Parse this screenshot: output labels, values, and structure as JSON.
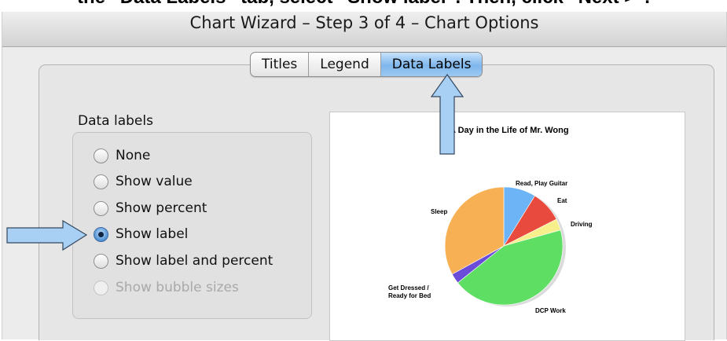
{
  "caption": {
    "prefix": "the “Data Labels” tab, select “",
    "bold_option": "Show label",
    "suffix": "”. Then, click “Next >”."
  },
  "window": {
    "title": "Chart Wizard – Step 3 of 4 – Chart Options"
  },
  "tabs": [
    {
      "label": "Titles",
      "selected": false
    },
    {
      "label": "Legend",
      "selected": false
    },
    {
      "label": "Data Labels",
      "selected": true
    }
  ],
  "data_labels": {
    "group_title": "Data labels",
    "options": [
      {
        "label": "None",
        "checked": false,
        "enabled": true
      },
      {
        "label": "Show value",
        "checked": false,
        "enabled": true
      },
      {
        "label": "Show percent",
        "checked": false,
        "enabled": true
      },
      {
        "label": "Show label",
        "checked": true,
        "enabled": true
      },
      {
        "label": "Show label and percent",
        "checked": false,
        "enabled": true
      },
      {
        "label": "Show bubble sizes",
        "checked": false,
        "enabled": false
      }
    ]
  },
  "preview": {
    "title": "A Day in the Life of Mr. Wong",
    "slices": [
      {
        "label": "Read, Play Guitar",
        "color": "#6cb4f5"
      },
      {
        "label": "Eat",
        "color": "#e84a3d"
      },
      {
        "label": "Driving",
        "color": "#f7ef8c"
      },
      {
        "label": "DCP Work",
        "color": "#5fde64"
      },
      {
        "label": "Get Dressed / Ready for Bed",
        "color": "#6b4cd9"
      },
      {
        "label": "Sleep",
        "color": "#f8b055"
      }
    ]
  },
  "annotation_arrows": [
    {
      "name": "pointer-to-data-labels-tab",
      "color": "#a8d0f4"
    },
    {
      "name": "pointer-to-show-label",
      "color": "#a8d0f4"
    }
  ]
}
